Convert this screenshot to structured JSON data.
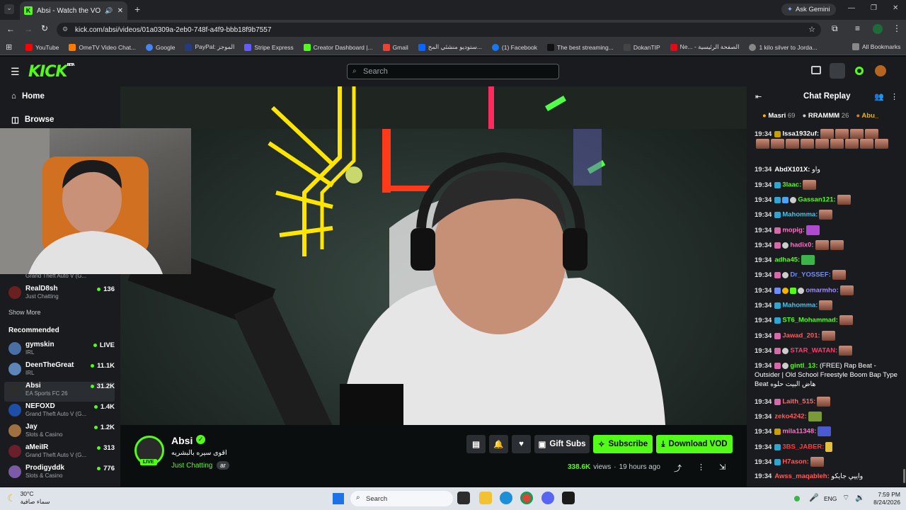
{
  "browser": {
    "tab_title": "Absi - Watch the VOD on K",
    "url": "kick.com/absi/videos/01a0309a-2eb0-748f-a4f9-bbb18f9b7557",
    "ask_gemini": "Ask Gemini",
    "bookmarks": [
      "YouTube",
      "OmeTV Video Chat...",
      "Google",
      "PayPal: الموجز",
      "Stripe Express",
      "Creator Dashboard |...",
      "Gmail",
      "ستوديو منشئي المح...",
      "(1) Facebook",
      "The best streaming...",
      "DokanTIP",
      "Ne... - الصفحة الرئيسية",
      "1 kilo silver to Jorda..."
    ],
    "all_bookmarks": "All Bookmarks"
  },
  "header": {
    "logo": "KICK",
    "beta": "BETA",
    "search_placeholder": "Search"
  },
  "sidebar": {
    "home": "Home",
    "browse": "Browse",
    "partial_game": "Grand Theft Auto V (G...",
    "following": [
      {
        "name": "RealD8sh",
        "game": "Just Chatting",
        "viewers": "136"
      }
    ],
    "show_more": "Show More",
    "recommended_title": "Recommended",
    "recommended": [
      {
        "name": "gymskin",
        "game": "IRL",
        "viewers": "LIVE",
        "color": "#4a6fa5"
      },
      {
        "name": "DeenTheGreat",
        "game": "IRL",
        "viewers": "11.1K",
        "color": "#5b86b7"
      },
      {
        "name": "Absi",
        "game": "EA Sports FC 26",
        "viewers": "31.2K",
        "color": "#2d2d2d"
      },
      {
        "name": "NEFOXD",
        "game": "Grand Theft Auto V (G...",
        "viewers": "1.4K",
        "color": "#1e4fa8"
      },
      {
        "name": "Jay",
        "game": "Slots & Casino",
        "viewers": "1.2K",
        "color": "#a07040"
      },
      {
        "name": "aMeiIR",
        "game": "Grand Theft Auto V (G...",
        "viewers": "313",
        "color": "#6b1f2a"
      },
      {
        "name": "Prodigyddk",
        "game": "Slots & Casino",
        "viewers": "776",
        "color": "#7d5aa6"
      }
    ]
  },
  "stream": {
    "channel": "Absi",
    "title": "اقوى سيره بالبشريه",
    "category": "Just Chatting",
    "language": "ar",
    "live": "LIVE",
    "gift_subs": "Gift Subs",
    "subscribe": "Subscribe",
    "download": "Download VOD",
    "views": "338.6K",
    "views_label": "views",
    "age": "19 hours ago"
  },
  "chat": {
    "title": "Chat Replay",
    "gifters": [
      {
        "name": "Masri",
        "count": "69"
      },
      {
        "name": "RRAMMM",
        "count": "26"
      },
      {
        "name": "Abu_",
        "count": ""
      }
    ],
    "messages": [
      {
        "time": "19:34",
        "user": "Issa1932uf:",
        "color": "#ffffff",
        "text": ""
      },
      {
        "time": "19:34",
        "user": "AbdX101X:",
        "color": "#ffffff",
        "text": "واو"
      },
      {
        "time": "19:34",
        "user": "3laac:",
        "color": "#53fc18",
        "text": ""
      },
      {
        "time": "19:34",
        "user": "Gassan121:",
        "color": "#53fc18",
        "text": ""
      },
      {
        "time": "19:34",
        "user": "Mahomma:",
        "color": "#43c6e8",
        "text": ""
      },
      {
        "time": "19:34",
        "user": "mopig:",
        "color": "#ff6ec7",
        "text": ""
      },
      {
        "time": "19:34",
        "user": "hadix0:",
        "color": "#ff6ec7",
        "text": ""
      },
      {
        "time": "19:34",
        "user": "adha45:",
        "color": "#53fc18",
        "text": ""
      },
      {
        "time": "19:34",
        "user": "Dr_YOSSEF:",
        "color": "#6f8cff",
        "text": ""
      },
      {
        "time": "19:34",
        "user": "omarmho:",
        "color": "#a18cff",
        "text": ""
      },
      {
        "time": "19:34",
        "user": "Mahomma:",
        "color": "#43c6e8",
        "text": ""
      },
      {
        "time": "19:34",
        "user": "ST6_Mohammad:",
        "color": "#53fc18",
        "text": ""
      },
      {
        "time": "19:34",
        "user": "Jawad_201:",
        "color": "#ff5a5a",
        "text": ""
      },
      {
        "time": "19:34",
        "user": "STAR_WATAN:",
        "color": "#ff3b6b",
        "text": ""
      },
      {
        "time": "19:34",
        "user": "gintl_13:",
        "color": "#53fc18",
        "text": "(FREE) Rap Beat - Outsider | Old School Freestyle Boom Bap Type Beat هاض البيت حلوه"
      },
      {
        "time": "19:34",
        "user": "Laith_515:",
        "color": "#ff6b6b",
        "text": ""
      },
      {
        "time": "19:34",
        "user": "zeko4242:",
        "color": "#ff5a5a",
        "text": ""
      },
      {
        "time": "19:34",
        "user": "mila11348:",
        "color": "#ff6ec7",
        "text": ""
      },
      {
        "time": "19:34",
        "user": "3BS_JABER:",
        "color": "#ff3b3b",
        "text": ""
      },
      {
        "time": "19:34",
        "user": "H7ason:",
        "color": "#ff5a5a",
        "text": ""
      },
      {
        "time": "19:34",
        "user": "Awss_maqableh:",
        "color": "#ff5a5a",
        "text": "واييي جايكو"
      }
    ]
  },
  "taskbar": {
    "temp": "30°C",
    "weather": "سماء صافية",
    "search": "Search",
    "lang": "ENG",
    "time": "7:59 PM",
    "date": "8/24/2026"
  }
}
